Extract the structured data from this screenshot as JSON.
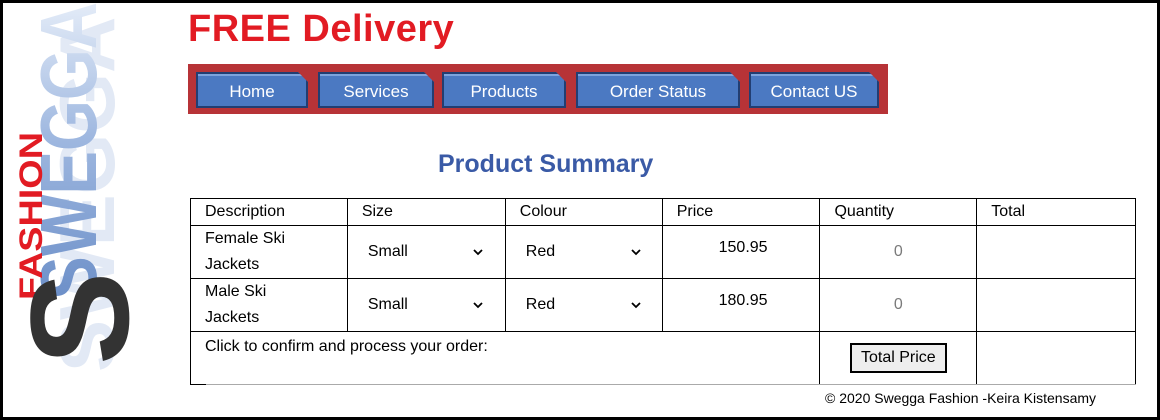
{
  "logo": {
    "word_main": "SWEGGA",
    "word_sub": "FASHION",
    "letter": "S"
  },
  "headline": "FREE Delivery",
  "colors": {
    "headline": "#e21b23",
    "nav_bar": "#b73337",
    "nav_button": "#4b79c2",
    "title": "#3a5aa6"
  },
  "nav": {
    "items": [
      "Home",
      "Services",
      "Products",
      "Order Status",
      "Contact US"
    ]
  },
  "summary_title": "Product Summary",
  "table": {
    "headers": [
      "Description",
      "Size",
      "Colour",
      "Price",
      "Quantity",
      "Total"
    ],
    "rows": [
      {
        "description_line1": "Female Ski",
        "description_line2": "Jackets",
        "size": "Small",
        "colour": "Red",
        "price": "150.95",
        "quantity": "0",
        "total": ""
      },
      {
        "description_line1": "Male Ski",
        "description_line2": "Jackets",
        "size": "Small",
        "colour": "Red",
        "price": "180.95",
        "quantity": "0",
        "total": ""
      }
    ],
    "confirm_text": "Click to confirm and process your order:",
    "total_button": "Total Price"
  },
  "footer": "© 2020 Swegga Fashion -Keira Kistensamy"
}
